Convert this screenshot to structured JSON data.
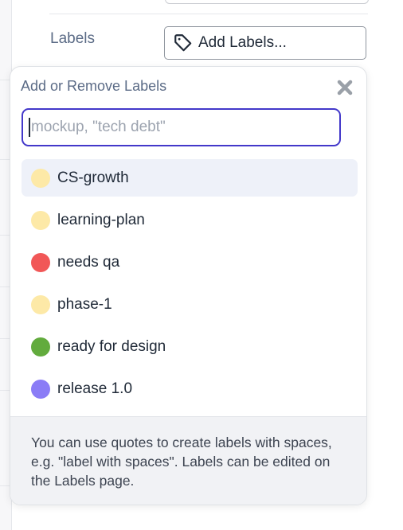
{
  "field": {
    "label": "Labels",
    "button_label": "Add Labels..."
  },
  "popover": {
    "title": "Add or Remove Labels",
    "search": {
      "value": "",
      "placeholder": "mockup, \"tech debt\""
    },
    "labels": [
      {
        "name": "CS-growth",
        "color": "#fde9a7",
        "highlighted": true
      },
      {
        "name": "learning-plan",
        "color": "#fde9a7",
        "highlighted": false
      },
      {
        "name": "needs qa",
        "color": "#f15757",
        "highlighted": false
      },
      {
        "name": "phase-1",
        "color": "#fde9a7",
        "highlighted": false
      },
      {
        "name": "ready for design",
        "color": "#62ab3d",
        "highlighted": false
      },
      {
        "name": "release 1.0",
        "color": "#8a7cf6",
        "highlighted": false
      }
    ],
    "footer_note": "You can use quotes to create labels with spaces, e.g. \"label with spaces\". Labels can be edited on the Labels page."
  },
  "icons": {
    "tag": "tag-icon",
    "close": "close-icon"
  }
}
